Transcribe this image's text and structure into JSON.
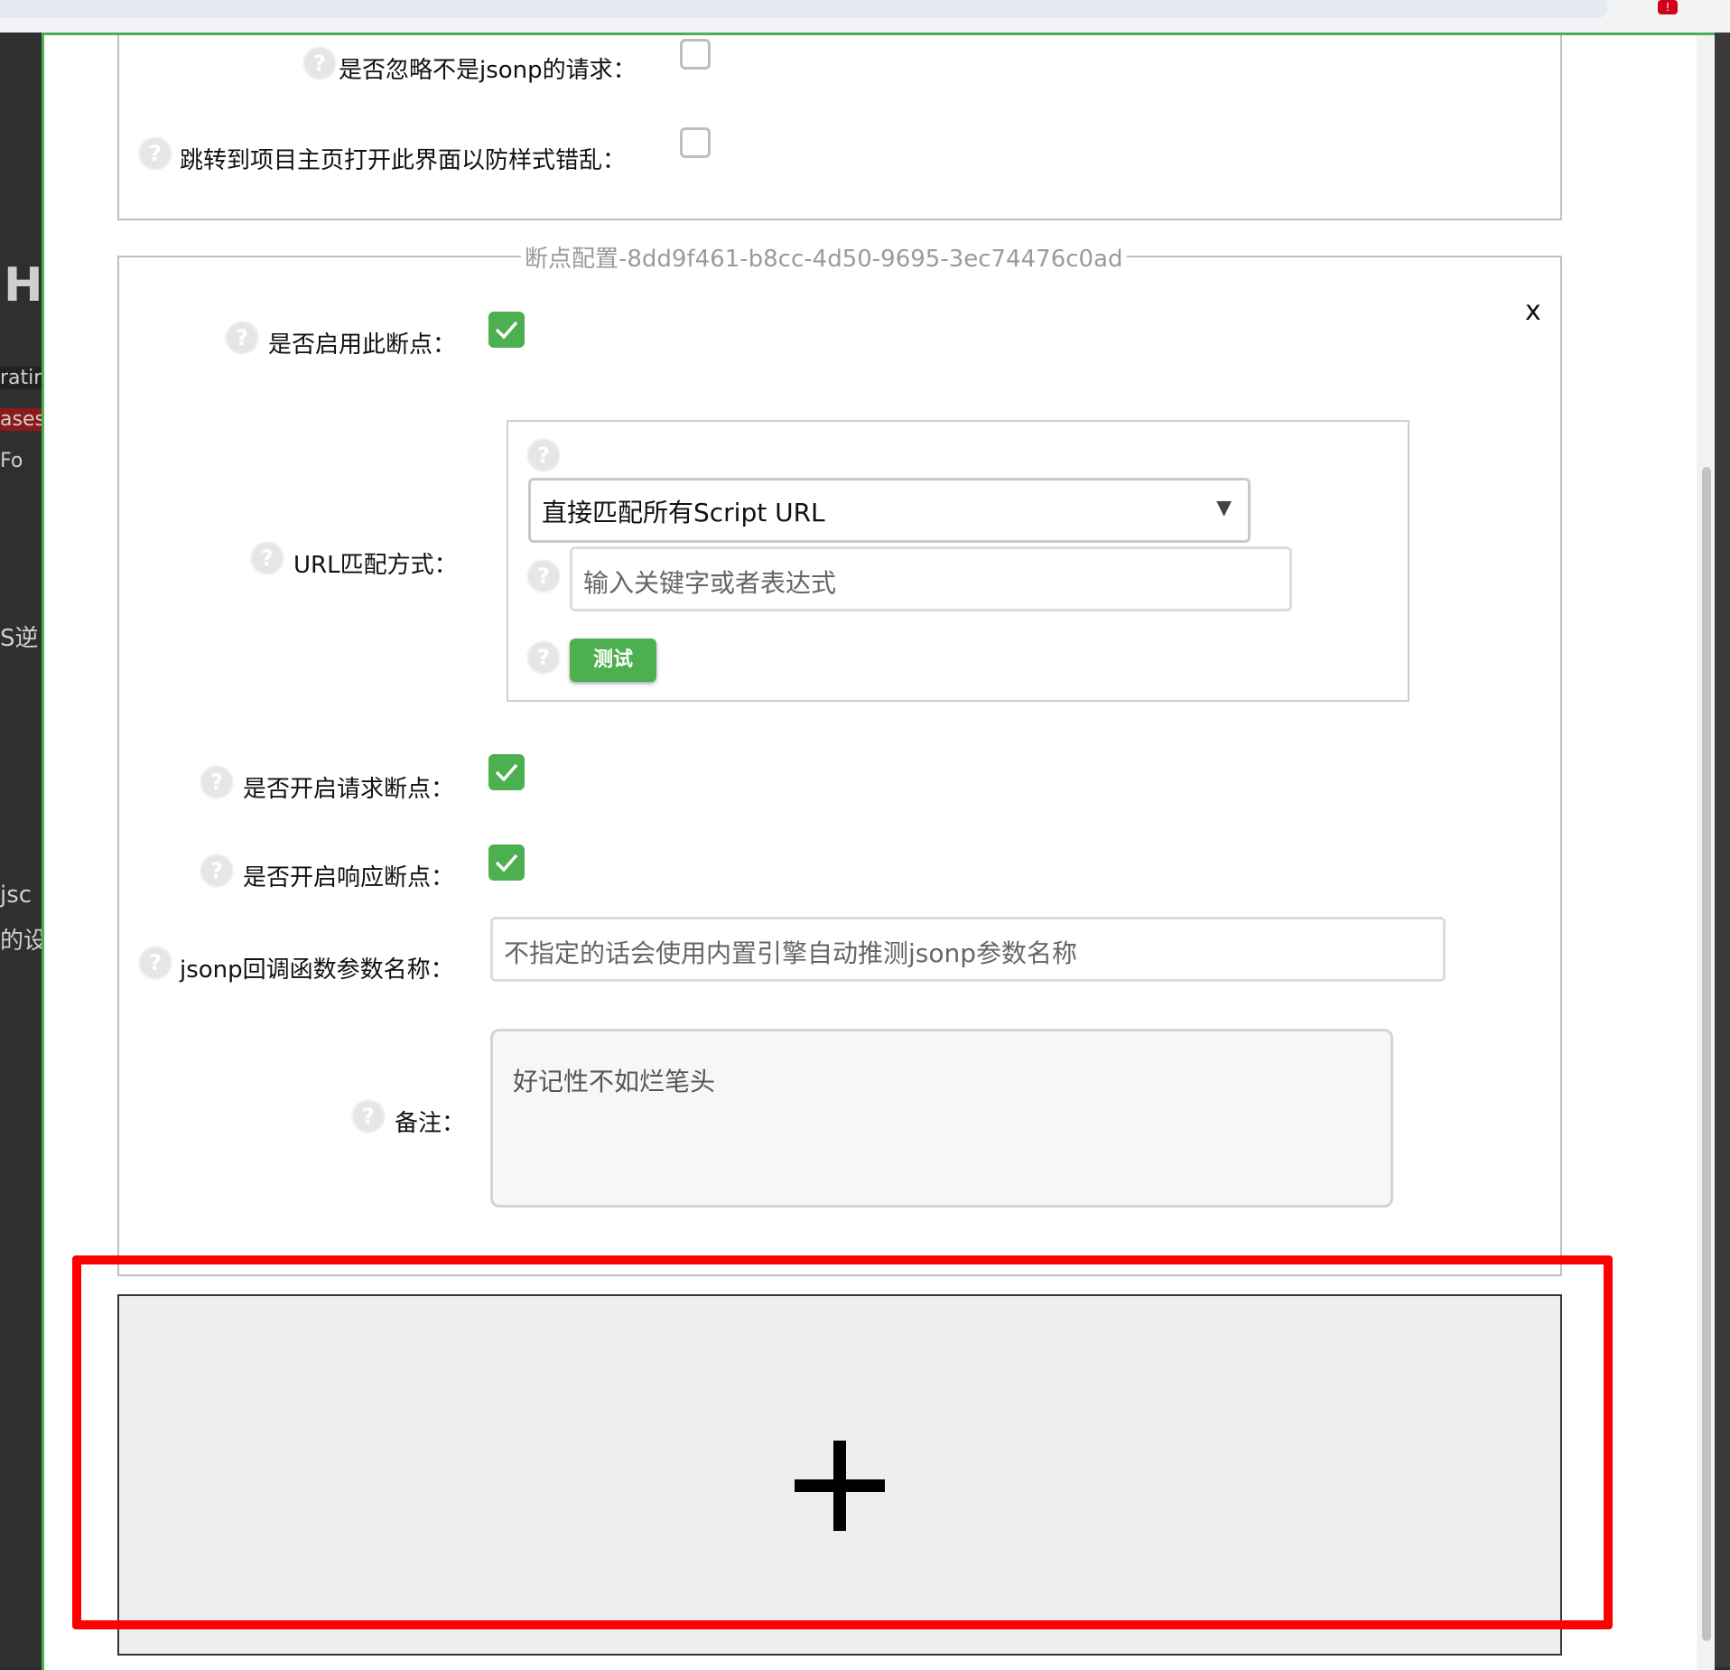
{
  "colors": {
    "accent_green": "#4caf50",
    "highlight_red": "#ff0000",
    "legend_gray": "#9a9a9a"
  },
  "browser": {
    "ext_badge": "!"
  },
  "background_fragments": [
    "H",
    "ratin",
    "ases",
    "Fo",
    "S逆",
    "jsc",
    "的设"
  ],
  "settings": {
    "ignore_non_jsonp": {
      "label": "是否忽略不是jsonp的请求：",
      "checked": false,
      "icon": "help-icon"
    },
    "open_homepage": {
      "label": "跳转到项目主页打开此界面以防样式错乱：",
      "checked": false,
      "icon": "help-icon"
    }
  },
  "breakpoint": {
    "legend": "断点配置-8dd9f461-b8cc-4d50-9695-3ec74476c0ad",
    "close_label": "x",
    "enable": {
      "label": "是否启用此断点：",
      "checked": true
    },
    "url_match": {
      "label": "URL匹配方式：",
      "select_value": "直接匹配所有Script URL",
      "select_arrow": "▼",
      "input_placeholder": "输入关键字或者表达式",
      "test_button": "测试"
    },
    "request_breakpoint": {
      "label": "是否开启请求断点：",
      "checked": true
    },
    "response_breakpoint": {
      "label": "是否开启响应断点：",
      "checked": true
    },
    "jsonp_callback": {
      "label": "jsonp回调函数参数名称：",
      "placeholder": "不指定的话会使用内置引擎自动推测jsonp参数名称"
    },
    "remark": {
      "label": "备注：",
      "placeholder": "好记性不如烂笔头"
    }
  },
  "add_panel": {
    "icon": "plus-icon"
  }
}
